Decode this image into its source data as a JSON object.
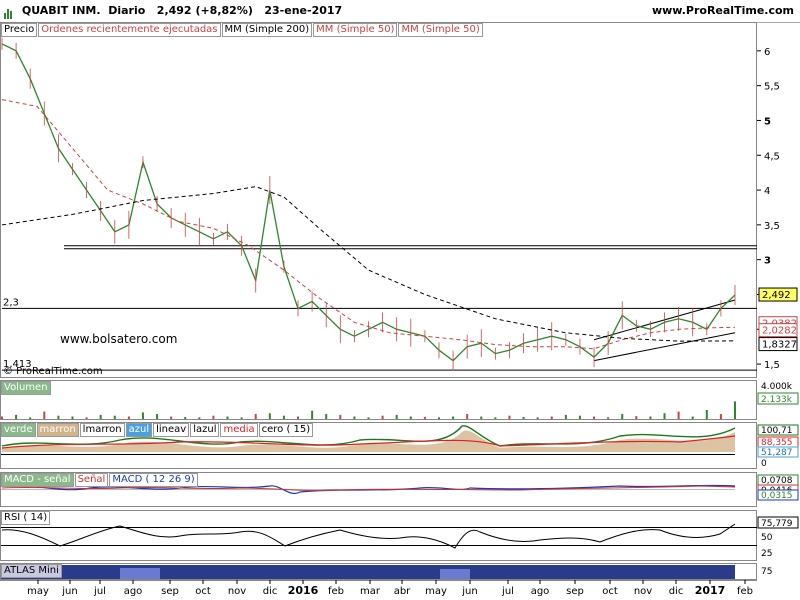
{
  "header": {
    "ticker": "QUABIT INM.",
    "period": "Diario",
    "price": "2,492",
    "change": "(+8,82%)",
    "date": "23-ene-2017",
    "site": "www.ProRealTime.com"
  },
  "price_legend": [
    "Precio",
    "Ordenes recientemente ejecutadas",
    "MM (Simple 200)",
    "MM (Simple 50)",
    "MM (Simple 50)"
  ],
  "volume_legend": [
    "Volumen"
  ],
  "custom_legend": [
    "verde",
    "marron",
    "lmarron",
    "azul",
    "lineav",
    "lazul",
    "media",
    "cero ( 15)"
  ],
  "macd_legend": [
    "MACD - señal",
    "Señal",
    "MACD ( 12 26 9)"
  ],
  "rsi_legend": [
    "RSI ( 14)"
  ],
  "atlas_legend": [
    "ATLAS Mini"
  ],
  "watermark": "www.bolsatero.com",
  "copyright": "© ProRealTime.com",
  "price_axis": {
    "ticks": [
      "6",
      "5,5",
      "5",
      "4,5",
      "4",
      "3,5",
      "3",
      "2,5",
      "2",
      "1,5"
    ],
    "left_labels": [
      "2,3",
      "1,413"
    ],
    "right_labels": [
      "2,492",
      "2,0382",
      "2,0282",
      "1,8327"
    ]
  },
  "volume_axis": {
    "ticks": [
      "4.000k"
    ],
    "last": "2.133k"
  },
  "custom_axis": {
    "ticks": [
      "100,71",
      "88,355",
      "51,287"
    ],
    "zero": "0"
  },
  "macd_axis": {
    "ticks": [
      "0,0708",
      "0,0416",
      "0,0315"
    ]
  },
  "rsi_axis": {
    "ticks": [
      "75,779",
      "50",
      "25"
    ]
  },
  "atlas_axis": {
    "ticks": [
      "75"
    ]
  },
  "x_axis": [
    "may",
    "jun",
    "jul",
    "ago",
    "sep",
    "oct",
    "nov",
    "dic",
    "2016",
    "feb",
    "mar",
    "abr",
    "may",
    "jun",
    "jul",
    "ago",
    "sep",
    "oct",
    "nov",
    "dic",
    "2017",
    "feb"
  ],
  "chart_data": {
    "type": "line",
    "title": "QUABIT INM. Diario 2,492 (+8,82%) 23-ene-2017",
    "xlabel": "",
    "ylabel": "",
    "ylim": [
      1.3,
      6.4
    ],
    "support_lines": [
      3.2,
      2.3,
      1.413
    ],
    "series": [
      {
        "name": "Precio",
        "points": [
          [
            0,
            6.1
          ],
          [
            4,
            6.0
          ],
          [
            8,
            5.6
          ],
          [
            12,
            5.1
          ],
          [
            16,
            4.6
          ],
          [
            20,
            4.3
          ],
          [
            24,
            4.0
          ],
          [
            28,
            3.7
          ],
          [
            32,
            3.4
          ],
          [
            36,
            3.5
          ],
          [
            40,
            4.4
          ],
          [
            44,
            3.8
          ],
          [
            48,
            3.6
          ],
          [
            52,
            3.5
          ],
          [
            56,
            3.4
          ],
          [
            60,
            3.3
          ],
          [
            64,
            3.4
          ],
          [
            68,
            3.2
          ],
          [
            72,
            2.7
          ],
          [
            76,
            4.0
          ],
          [
            80,
            2.9
          ],
          [
            84,
            2.3
          ],
          [
            88,
            2.4
          ],
          [
            92,
            2.2
          ],
          [
            96,
            2.0
          ],
          [
            100,
            1.9
          ],
          [
            104,
            2.0
          ],
          [
            108,
            2.1
          ],
          [
            112,
            2.0
          ],
          [
            116,
            1.95
          ],
          [
            120,
            1.9
          ],
          [
            124,
            1.7
          ],
          [
            128,
            1.55
          ],
          [
            132,
            1.75
          ],
          [
            136,
            1.8
          ],
          [
            140,
            1.65
          ],
          [
            144,
            1.7
          ],
          [
            148,
            1.8
          ],
          [
            152,
            1.85
          ],
          [
            156,
            1.9
          ],
          [
            160,
            1.85
          ],
          [
            164,
            1.75
          ],
          [
            168,
            1.6
          ],
          [
            172,
            1.8
          ],
          [
            176,
            2.2
          ],
          [
            180,
            2.05
          ],
          [
            184,
            2.0
          ],
          [
            188,
            2.1
          ],
          [
            192,
            2.15
          ],
          [
            196,
            2.1
          ],
          [
            200,
            2.0
          ],
          [
            204,
            2.3
          ],
          [
            208,
            2.492
          ]
        ]
      },
      {
        "name": "MM (Simple 200)",
        "points": [
          [
            0,
            3.5
          ],
          [
            20,
            3.65
          ],
          [
            40,
            3.85
          ],
          [
            60,
            3.95
          ],
          [
            72,
            4.05
          ],
          [
            80,
            3.9
          ],
          [
            90,
            3.45
          ],
          [
            104,
            2.85
          ],
          [
            120,
            2.5
          ],
          [
            140,
            2.15
          ],
          [
            160,
            1.95
          ],
          [
            176,
            1.87
          ],
          [
            192,
            1.83
          ],
          [
            208,
            1.8327
          ]
        ]
      },
      {
        "name": "MM (Simple 50)",
        "points": [
          [
            0,
            5.3
          ],
          [
            10,
            5.2
          ],
          [
            20,
            4.6
          ],
          [
            30,
            4.0
          ],
          [
            40,
            3.8
          ],
          [
            50,
            3.55
          ],
          [
            60,
            3.45
          ],
          [
            70,
            3.2
          ],
          [
            80,
            2.85
          ],
          [
            90,
            2.45
          ],
          [
            100,
            2.1
          ],
          [
            110,
            1.95
          ],
          [
            120,
            1.9
          ],
          [
            130,
            1.85
          ],
          [
            140,
            1.78
          ],
          [
            150,
            1.75
          ],
          [
            160,
            1.75
          ],
          [
            168,
            1.72
          ],
          [
            176,
            1.85
          ],
          [
            184,
            1.95
          ],
          [
            192,
            2.0
          ],
          [
            200,
            2.02
          ],
          [
            208,
            2.0282
          ]
        ]
      }
    ],
    "channel": {
      "lower": [
        [
          168,
          1.55
        ],
        [
          208,
          1.95
        ]
      ],
      "upper": [
        [
          168,
          1.85
        ],
        [
          208,
          2.42
        ]
      ]
    },
    "volume_k": [
      300,
      500,
      200,
      900,
      400,
      300,
      200,
      500,
      400,
      300,
      800,
      600,
      300,
      250,
      200,
      400,
      300,
      200,
      600,
      700,
      400,
      300,
      1000,
      600,
      500,
      300,
      200,
      400,
      500,
      300,
      250,
      200,
      300,
      600,
      300,
      200,
      400,
      250,
      200,
      300,
      500,
      400,
      300,
      200,
      600,
      350,
      300,
      700,
      900,
      300,
      1100,
      600,
      2133
    ]
  }
}
